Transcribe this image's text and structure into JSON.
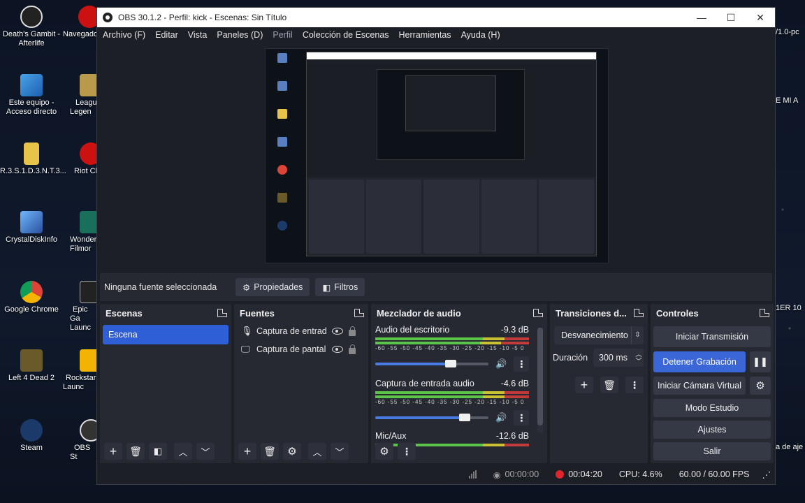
{
  "desktop": {
    "icons_col1": [
      "Death's Gambit - Afterlife",
      "Este equipo - Acceso directo",
      "R.3.S.1.D.3.N.T.3...",
      "CrystalDiskInfo",
      "Google Chrome",
      "Left 4 Dead 2",
      "Steam"
    ],
    "icons_col2": [
      "Navegado",
      "League Legen",
      "Riot Cl",
      "Wonder Filmor",
      "Epic Ga Launc",
      "Rockstar Launc",
      "OBS St"
    ],
    "right_peek": [
      "/1.0-pc",
      "E MI A",
      "1ER 10",
      "a de aje"
    ]
  },
  "window": {
    "title": "OBS 30.1.2 - Perfil: kick - Escenas: Sin Título",
    "minimize": "—",
    "maximize": "☐",
    "close": "✕"
  },
  "menu": [
    "Archivo (F)",
    "Editar",
    "Vista",
    "Paneles (D)",
    "Perfil",
    "Colección de Escenas",
    "Herramientas",
    "Ayuda (H)"
  ],
  "source_bar": {
    "no_source": "Ninguna fuente seleccionada",
    "properties": "Propiedades",
    "filters": "Filtros"
  },
  "scenes": {
    "title": "Escenas",
    "items": [
      "Escena"
    ]
  },
  "sources": {
    "title": "Fuentes",
    "items": [
      "Captura de entrada de audio",
      "Captura de pantalla"
    ]
  },
  "mixer": {
    "title": "Mezclador de audio",
    "scale": "-60 -55 -50 -45 -40 -35 -30 -25 -20 -15 -10 -5 0",
    "channels": [
      {
        "name": "Audio del escritorio",
        "db": "-9.3 dB",
        "volume": 0.65
      },
      {
        "name": "Captura de entrada audio",
        "db": "-4.6 dB",
        "volume": 0.77
      },
      {
        "name": "Mic/Aux",
        "db": "-12.6 dB",
        "volume": 0.5
      }
    ]
  },
  "transitions": {
    "title": "Transiciones d...",
    "type": "Desvanecimiento",
    "duration_label": "Duración",
    "duration_value": "300 ms"
  },
  "controls": {
    "title": "Controles",
    "start_stream": "Iniciar Transmisión",
    "stop_record": "Detener Grabación",
    "pause_icon": "❚❚",
    "virtual_cam": "Iniciar Cámara Virtual",
    "studio_mode": "Modo Estudio",
    "settings": "Ajustes",
    "exit": "Salir"
  },
  "status": {
    "stream_time": "00:00:00",
    "record_time": "00:04:20",
    "cpu": "CPU: 4.6%",
    "fps": "60.00 / 60.00 FPS"
  },
  "colors": {
    "accent": "#3b66d8",
    "record": "#e0242c",
    "meter_green": "#5bc24a"
  }
}
